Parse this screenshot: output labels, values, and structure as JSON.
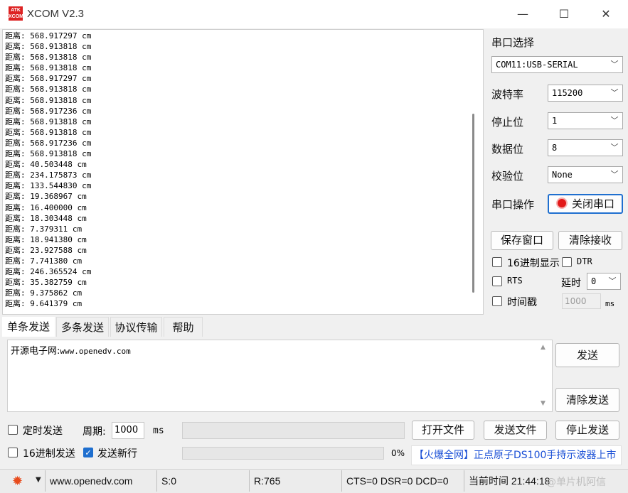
{
  "window": {
    "logo_text": "ATK XCOM",
    "title": "XCOM V2.3",
    "minimize": "—",
    "maximize": "☐",
    "close": "✕"
  },
  "receive": {
    "lines": [
      "距离: 568.917297 cm",
      "距离: 568.913818 cm",
      "距离: 568.913818 cm",
      "距离: 568.913818 cm",
      "距离: 568.917297 cm",
      "距离: 568.913818 cm",
      "距离: 568.913818 cm",
      "距离: 568.917236 cm",
      "距离: 568.913818 cm",
      "距离: 568.913818 cm",
      "距离: 568.917236 cm",
      "距离: 568.913818 cm",
      "距离: 40.503448 cm",
      "距离: 234.175873 cm",
      "距离: 133.544830 cm",
      "距离: 19.368967 cm",
      "距离: 16.400000 cm",
      "距离: 18.303448 cm",
      "距离: 7.379311 cm",
      "距离: 18.941380 cm",
      "距离: 23.927588 cm",
      "距离: 7.741380 cm",
      "距离: 246.365524 cm",
      "距离: 35.382759 cm",
      "距离: 9.375862 cm",
      "距离: 9.641379 cm"
    ]
  },
  "settings": {
    "port_select_label": "串口选择",
    "port_value": "COM11:USB-SERIAL",
    "baud_label": "波特率",
    "baud_value": "115200",
    "stop_label": "停止位",
    "stop_value": "1",
    "data_label": "数据位",
    "data_value": "8",
    "parity_label": "校验位",
    "parity_value": "None",
    "op_label": "串口操作",
    "close_port_button": "关闭串口",
    "save_window_button": "保存窗口",
    "clear_recv_button": "清除接收",
    "hex_display_label": "16进制显示",
    "dtr_label": "DTR",
    "rts_label": "RTS",
    "delay_label": "延时",
    "delay_value": "0",
    "timestamp_label": "时间戳",
    "timestamp_value": "1000",
    "timestamp_unit": "ms"
  },
  "tabs": [
    "单条发送",
    "多条发送",
    "协议传输",
    "帮助"
  ],
  "send": {
    "text_cn": "开源电子网:",
    "text_url": "www.openedv.com",
    "send_button": "发送",
    "clear_send_button": "清除发送",
    "timed_send_label": "定时发送",
    "period_label": "周期:",
    "period_value": "1000",
    "period_unit": "ms",
    "open_file_button": "打开文件",
    "send_file_button": "发送文件",
    "stop_send_button": "停止发送",
    "hex_send_label": "16进制发送",
    "send_newline_label": "发送新行",
    "progress_percent": "0%",
    "progress_value": 0,
    "ad_text": "【火爆全网】正点原子DS100手持示波器上市"
  },
  "status": {
    "website": "www.openedv.com",
    "sent": "S:0",
    "received": "R:765",
    "lines": "CTS=0 DSR=0 DCD=0",
    "time": "当前时间 21:44:18",
    "watermark": "@单片机阿信"
  },
  "colors": {
    "accent": "#1f6fcf",
    "ad_text": "#1a4fd6",
    "port_open_indicator": "#e21818"
  }
}
